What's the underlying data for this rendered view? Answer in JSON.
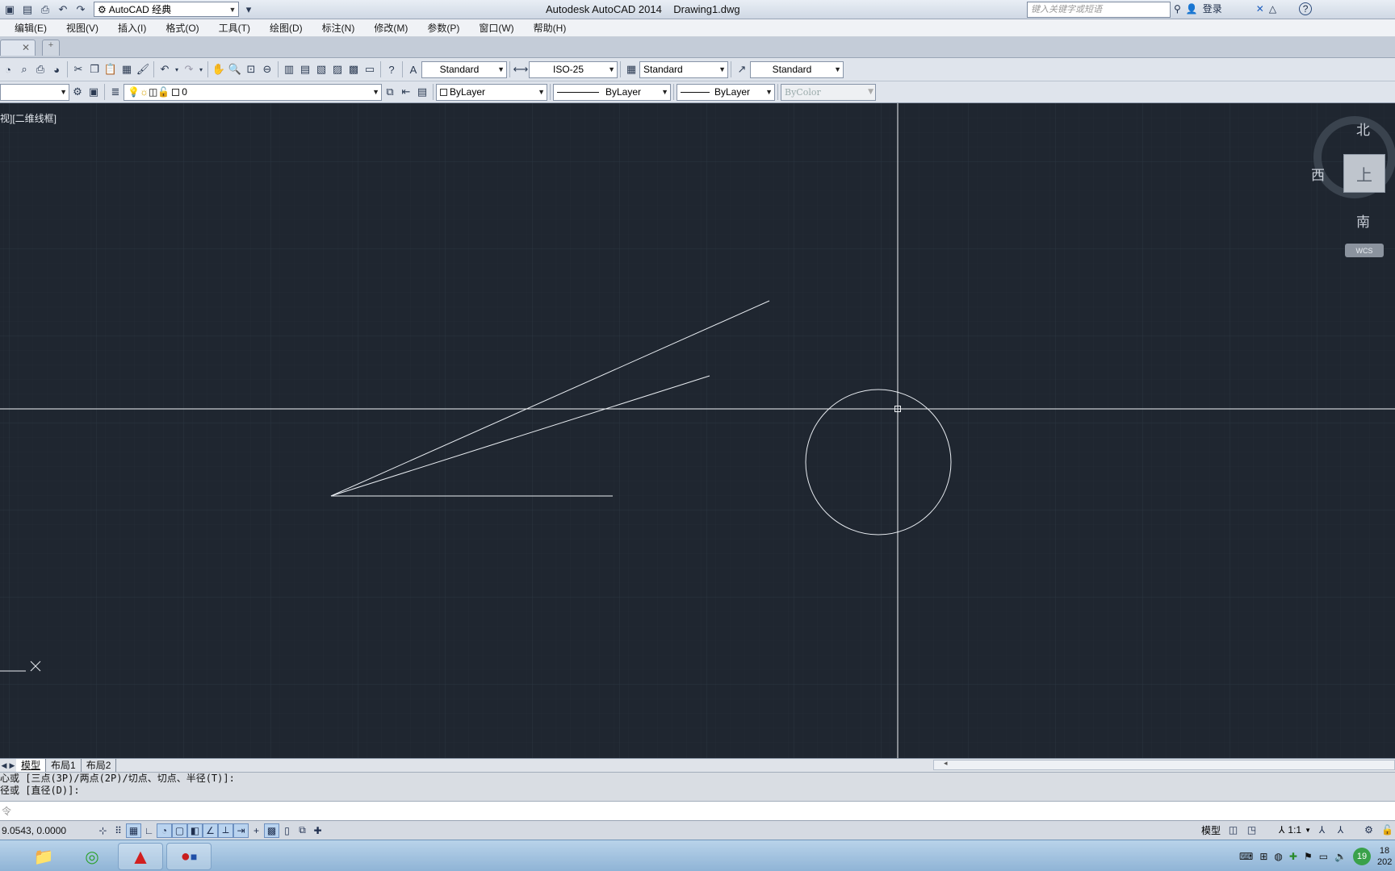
{
  "app": {
    "title": "Autodesk AutoCAD 2014    Drawing1.dwg",
    "workspace": "AutoCAD 经典",
    "search_placeholder": "键入关键字或短语",
    "login": "登录",
    "help": "?"
  },
  "menu": [
    "编辑(E)",
    "视图(V)",
    "插入(I)",
    "格式(O)",
    "工具(T)",
    "绘图(D)",
    "标注(N)",
    "修改(M)",
    "参数(P)",
    "窗口(W)",
    "帮助(H)"
  ],
  "styles_toolbar": {
    "text_style": "Standard",
    "dim_style": "ISO-25",
    "table_style": "Standard",
    "multileader_style": "Standard"
  },
  "layers_toolbar": {
    "layer": "0",
    "color": "ByLayer",
    "linetype": "ByLayer",
    "lineweight": "ByLayer",
    "plotstyle": "ByColor"
  },
  "viewport": {
    "label": "视][二维线框]",
    "compass": {
      "north": "北",
      "south": "南",
      "west": "西",
      "top": "上"
    },
    "ucs": "WCS"
  },
  "layout_tabs": [
    "模型",
    "布局1",
    "布局2"
  ],
  "command": {
    "history": [
      "心或 [三点(3P)/两点(2P)/切点、切点、半径(T)]:",
      "径或 [直径(D)]:"
    ],
    "prompt": "令"
  },
  "status": {
    "coords": "9.0543,  0.0000",
    "model": "模型",
    "scale": "1:1"
  },
  "tray": {
    "badge": "19",
    "time": "18",
    "date": "202"
  },
  "colors": {
    "canvas": "#1f2630",
    "grid": "#27303b",
    "lines": "#e8ecf1"
  }
}
